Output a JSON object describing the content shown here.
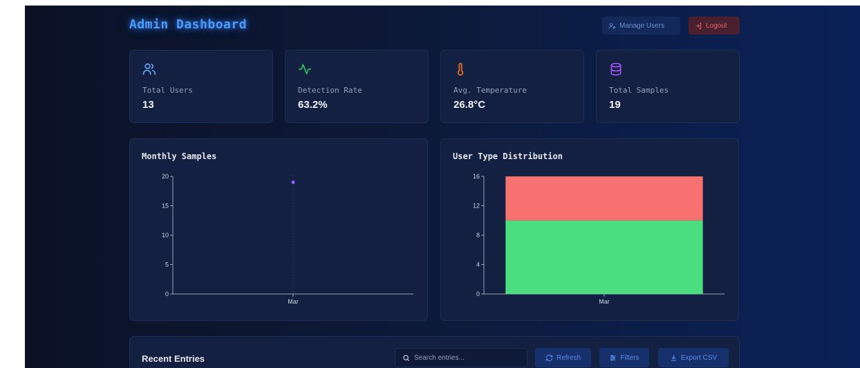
{
  "header": {
    "title": "Admin Dashboard",
    "manage_users": "Manage Users",
    "logout": "Logout"
  },
  "stats": [
    {
      "label": "Total Users",
      "value": "13",
      "icon": "users-icon",
      "color": "#60a5fa"
    },
    {
      "label": "Detection Rate",
      "value": "63.2%",
      "icon": "activity-icon",
      "color": "#22c55e"
    },
    {
      "label": "Avg. Temperature",
      "value": "26.8°C",
      "icon": "thermometer-icon",
      "color": "#f97316"
    },
    {
      "label": "Total Samples",
      "value": "19",
      "icon": "database-icon",
      "color": "#a855f7"
    }
  ],
  "charts": {
    "monthly": {
      "title": "Monthly Samples"
    },
    "distribution": {
      "title": "User Type Distribution"
    }
  },
  "chart_data": [
    {
      "type": "line",
      "title": "Monthly Samples",
      "categories": [
        "Mar"
      ],
      "series": [
        {
          "values": [
            19
          ],
          "color": "#8b5cf6"
        }
      ],
      "yticks": [
        0,
        5,
        10,
        15,
        20
      ],
      "ylim": [
        0,
        20
      ],
      "grid": false
    },
    {
      "type": "bar",
      "stacked": true,
      "title": "User Type Distribution",
      "categories": [
        "Mar"
      ],
      "series": [
        {
          "values": [
            10
          ],
          "color": "#4ade80"
        },
        {
          "values": [
            6
          ],
          "color": "#f87171"
        }
      ],
      "yticks": [
        0,
        4,
        8,
        12,
        16
      ],
      "ylim": [
        0,
        16
      ],
      "grid": false
    }
  ],
  "entries": {
    "title": "Recent Entries",
    "search_placeholder": "Search entries...",
    "refresh": "Refresh",
    "filters": "Filters",
    "export": "Export CSV"
  },
  "colors": {
    "accent": "#3b82f6",
    "logout": "#e06a6a"
  }
}
